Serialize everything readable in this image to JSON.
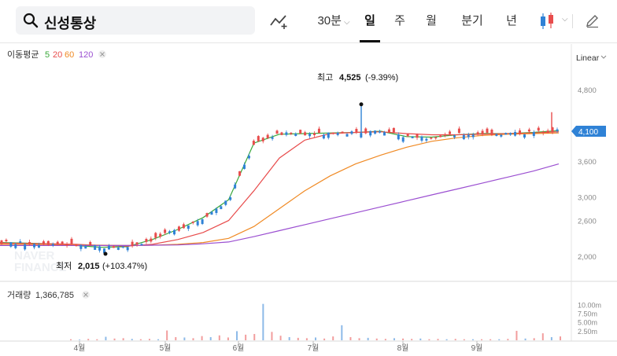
{
  "toolbar": {
    "search_value": "신성통상",
    "interval_30m": "30분",
    "tabs": [
      "일",
      "주",
      "월",
      "분기",
      "년"
    ],
    "active_tab": "일"
  },
  "colors": {
    "up": "#e84c4c",
    "down": "#2f82d6",
    "ma5": "#3aa83a",
    "ma20": "#e84c4c",
    "ma60": "#f08a24",
    "ma120": "#9b4fd1",
    "accent": "#2f82d6"
  },
  "icons": [
    "search-icon",
    "compare-line-icon",
    "candle-type-icon",
    "pencil-icon",
    "chevron-down-icon",
    "close-icon"
  ],
  "chart_data": [
    {
      "type": "candlestick",
      "title": "이동평균",
      "legend": {
        "label": "이동평균",
        "series": [
          "5",
          "20",
          "60",
          "120"
        ]
      },
      "scale_label": "Linear",
      "x": [
        "4월",
        "5월",
        "6월",
        "7월",
        "8월",
        "9월"
      ],
      "y_ticks": [
        "4,800",
        "4,100",
        "3,600",
        "3,000",
        "2,600",
        "2,000"
      ],
      "ylim": [
        1750,
        5050
      ],
      "last_price": "4,100",
      "annotations": {
        "high": {
          "label": "최고",
          "value": "4,525",
          "change": "(-9.39%)"
        },
        "low": {
          "label": "최저",
          "value": "2,015",
          "change": "(+103.47%)"
        }
      },
      "series": [
        {
          "name": "5",
          "values": [
            2230,
            2220,
            2210,
            2180,
            2150,
            2160,
            2280,
            2450,
            2650,
            2950,
            3900,
            4050,
            4060,
            4070,
            4080,
            4100,
            4010,
            4000,
            4040,
            4060,
            4060,
            4080,
            4110
          ]
        },
        {
          "name": "20",
          "values": [
            2220,
            2215,
            2210,
            2200,
            2180,
            2170,
            2200,
            2280,
            2400,
            2600,
            3100,
            3650,
            3950,
            4060,
            4080,
            4090,
            4060,
            4040,
            4040,
            4050,
            4060,
            4070,
            4090
          ]
        },
        {
          "name": "60",
          "values": [
            2200,
            2200,
            2195,
            2190,
            2185,
            2180,
            2185,
            2200,
            2230,
            2300,
            2500,
            2800,
            3100,
            3350,
            3550,
            3700,
            3830,
            3930,
            3990,
            4030,
            4050,
            4060,
            4070
          ]
        },
        {
          "name": "120",
          "values": [
            2180,
            2180,
            2180,
            2180,
            2180,
            2180,
            2185,
            2190,
            2210,
            2240,
            2330,
            2430,
            2530,
            2630,
            2730,
            2830,
            2930,
            3030,
            3130,
            3230,
            3330,
            3430,
            3550
          ]
        }
      ]
    },
    {
      "type": "bar",
      "title": "거래량",
      "value": "1,366,785",
      "y_ticks": [
        "10.00m",
        "7.50m",
        "5.00m",
        "2.50m"
      ],
      "ylim": [
        0,
        11
      ],
      "values": [
        0.3,
        0.2,
        0.4,
        0.3,
        1.0,
        0.5,
        0.6,
        0.4,
        0.3,
        0.4,
        0.3,
        2.8,
        0.9,
        0.8,
        0.6,
        1.2,
        0.9,
        1.4,
        0.8,
        2.6,
        1.6,
        1.8,
        10.4,
        2.4,
        1.3,
        0.9,
        0.7,
        0.6,
        0.8,
        0.5,
        1.1,
        4.3,
        0.9,
        0.6,
        0.7,
        0.5,
        0.4,
        0.6,
        0.5,
        0.4,
        0.5,
        0.3,
        0.4,
        0.3,
        0.4,
        0.3,
        0.3,
        0.3,
        0.3,
        0.3,
        0.4,
        2.7,
        0.5,
        0.6,
        2.0,
        0.9,
        1.1
      ]
    }
  ]
}
